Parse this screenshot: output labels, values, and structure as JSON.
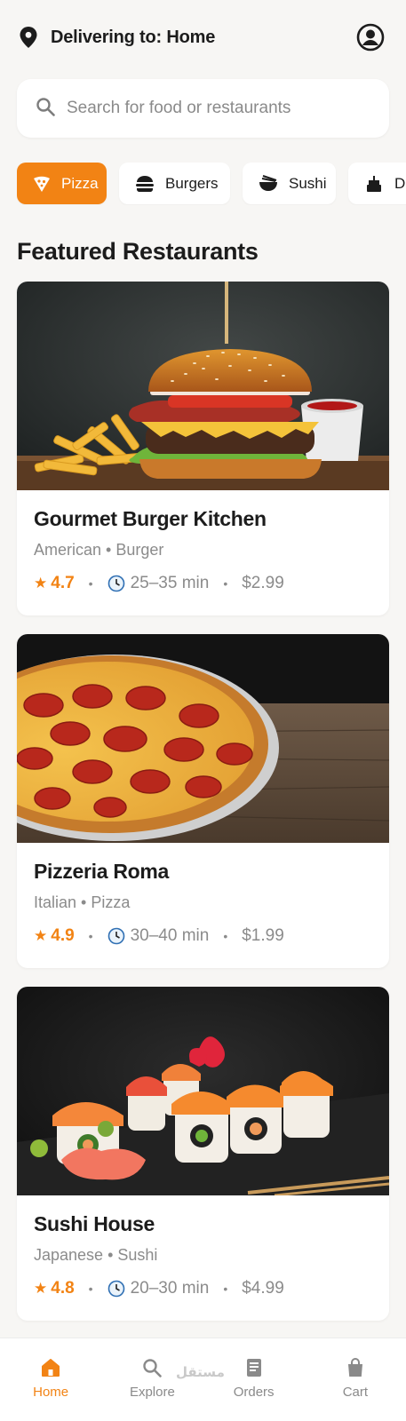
{
  "header": {
    "location_label": "Delivering to: Home"
  },
  "search": {
    "placeholder": "Search for food or restaurants",
    "value": ""
  },
  "categories": [
    {
      "label": "Pizza",
      "icon": "pizza-icon",
      "active": true
    },
    {
      "label": "Burgers",
      "icon": "burger-icon",
      "active": false
    },
    {
      "label": "Sushi",
      "icon": "noodle-bowl-icon",
      "active": false
    },
    {
      "label": "D",
      "icon": "cake-icon",
      "active": false
    }
  ],
  "section": {
    "title": "Featured Restaurants"
  },
  "restaurants": [
    {
      "name": "Gourmet Burger Kitchen",
      "cuisine": "American • Burger",
      "rating": "4.7",
      "time": "25–35 min",
      "fee": "$2.99",
      "image": "burger-photo"
    },
    {
      "name": "Pizzeria Roma",
      "cuisine": "Italian • Pizza",
      "rating": "4.9",
      "time": "30–40 min",
      "fee": "$1.99",
      "image": "pizza-photo"
    },
    {
      "name": "Sushi House",
      "cuisine": "Japanese • Sushi",
      "rating": "4.8",
      "time": "20–30 min",
      "fee": "$4.99",
      "image": "sushi-photo"
    }
  ],
  "nav": [
    {
      "label": "Home",
      "icon": "home-icon",
      "active": true
    },
    {
      "label": "Explore",
      "icon": "search-icon",
      "active": false
    },
    {
      "label": "Orders",
      "icon": "receipt-icon",
      "active": false
    },
    {
      "label": "Cart",
      "icon": "shopping-bag-icon",
      "active": false
    }
  ],
  "watermark": "مستقل",
  "colors": {
    "accent": "#f28314",
    "background": "#f7f6f4",
    "muted": "#8b8b8b"
  }
}
